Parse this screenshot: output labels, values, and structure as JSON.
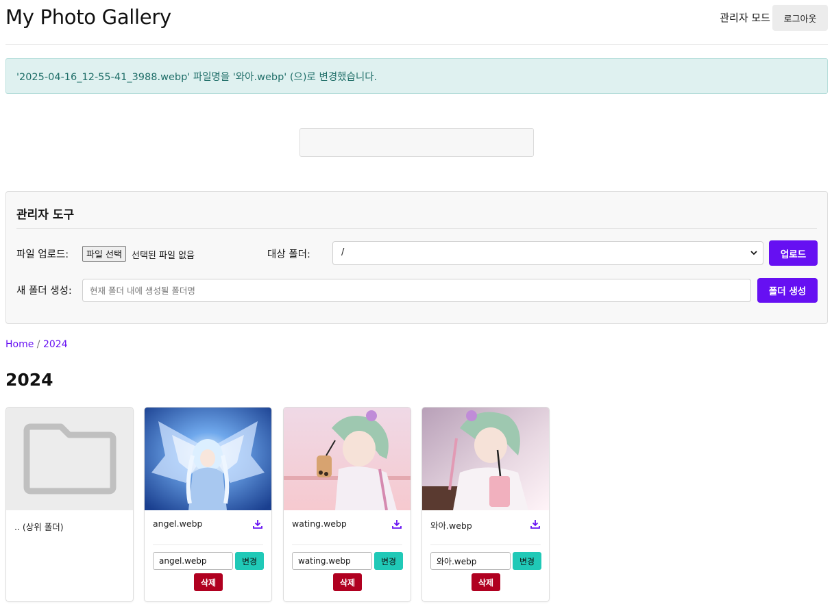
{
  "header": {
    "title": "My Photo Gallery",
    "admin_mode": "관리자 모드",
    "logout": "로그아웃"
  },
  "alert": {
    "message": "'2025-04-16_12-55-41_3988.webp' 파일명을 '와아.webp' (으)로 변경했습니다."
  },
  "admin": {
    "title": "관리자 도구",
    "upload_label": "파일 업로드:",
    "file_button": "파일 선택",
    "file_status": "선택된 파일 없음",
    "target_label": "대상 폴더:",
    "target_value": "/",
    "upload_button": "업로드",
    "newfolder_label": "새 폴더 생성:",
    "newfolder_placeholder": "현재 폴더 내에 생성될 폴더명",
    "newfolder_button": "폴더 생성"
  },
  "breadcrumb": {
    "home": "Home",
    "separator": " / ",
    "current": "2024"
  },
  "folder_title": "2024",
  "parent_folder": {
    "label": ".. (상위 폴더)"
  },
  "cards": [
    {
      "name": "angel.webp",
      "input_value": "angel.webp",
      "rename": "변경",
      "delete": "삭제"
    },
    {
      "name": "wating.webp",
      "input_value": "wating.webp",
      "rename": "변경",
      "delete": "삭제"
    },
    {
      "name": "와아.webp",
      "input_value": "와아.webp",
      "rename": "변경",
      "delete": "삭제"
    }
  ],
  "colors": {
    "accent": "#6610f2",
    "alert_bg": "#dff1f0",
    "alert_text": "#1f6e68",
    "rename_button": "#20c9b7",
    "delete_button": "#b00020"
  }
}
